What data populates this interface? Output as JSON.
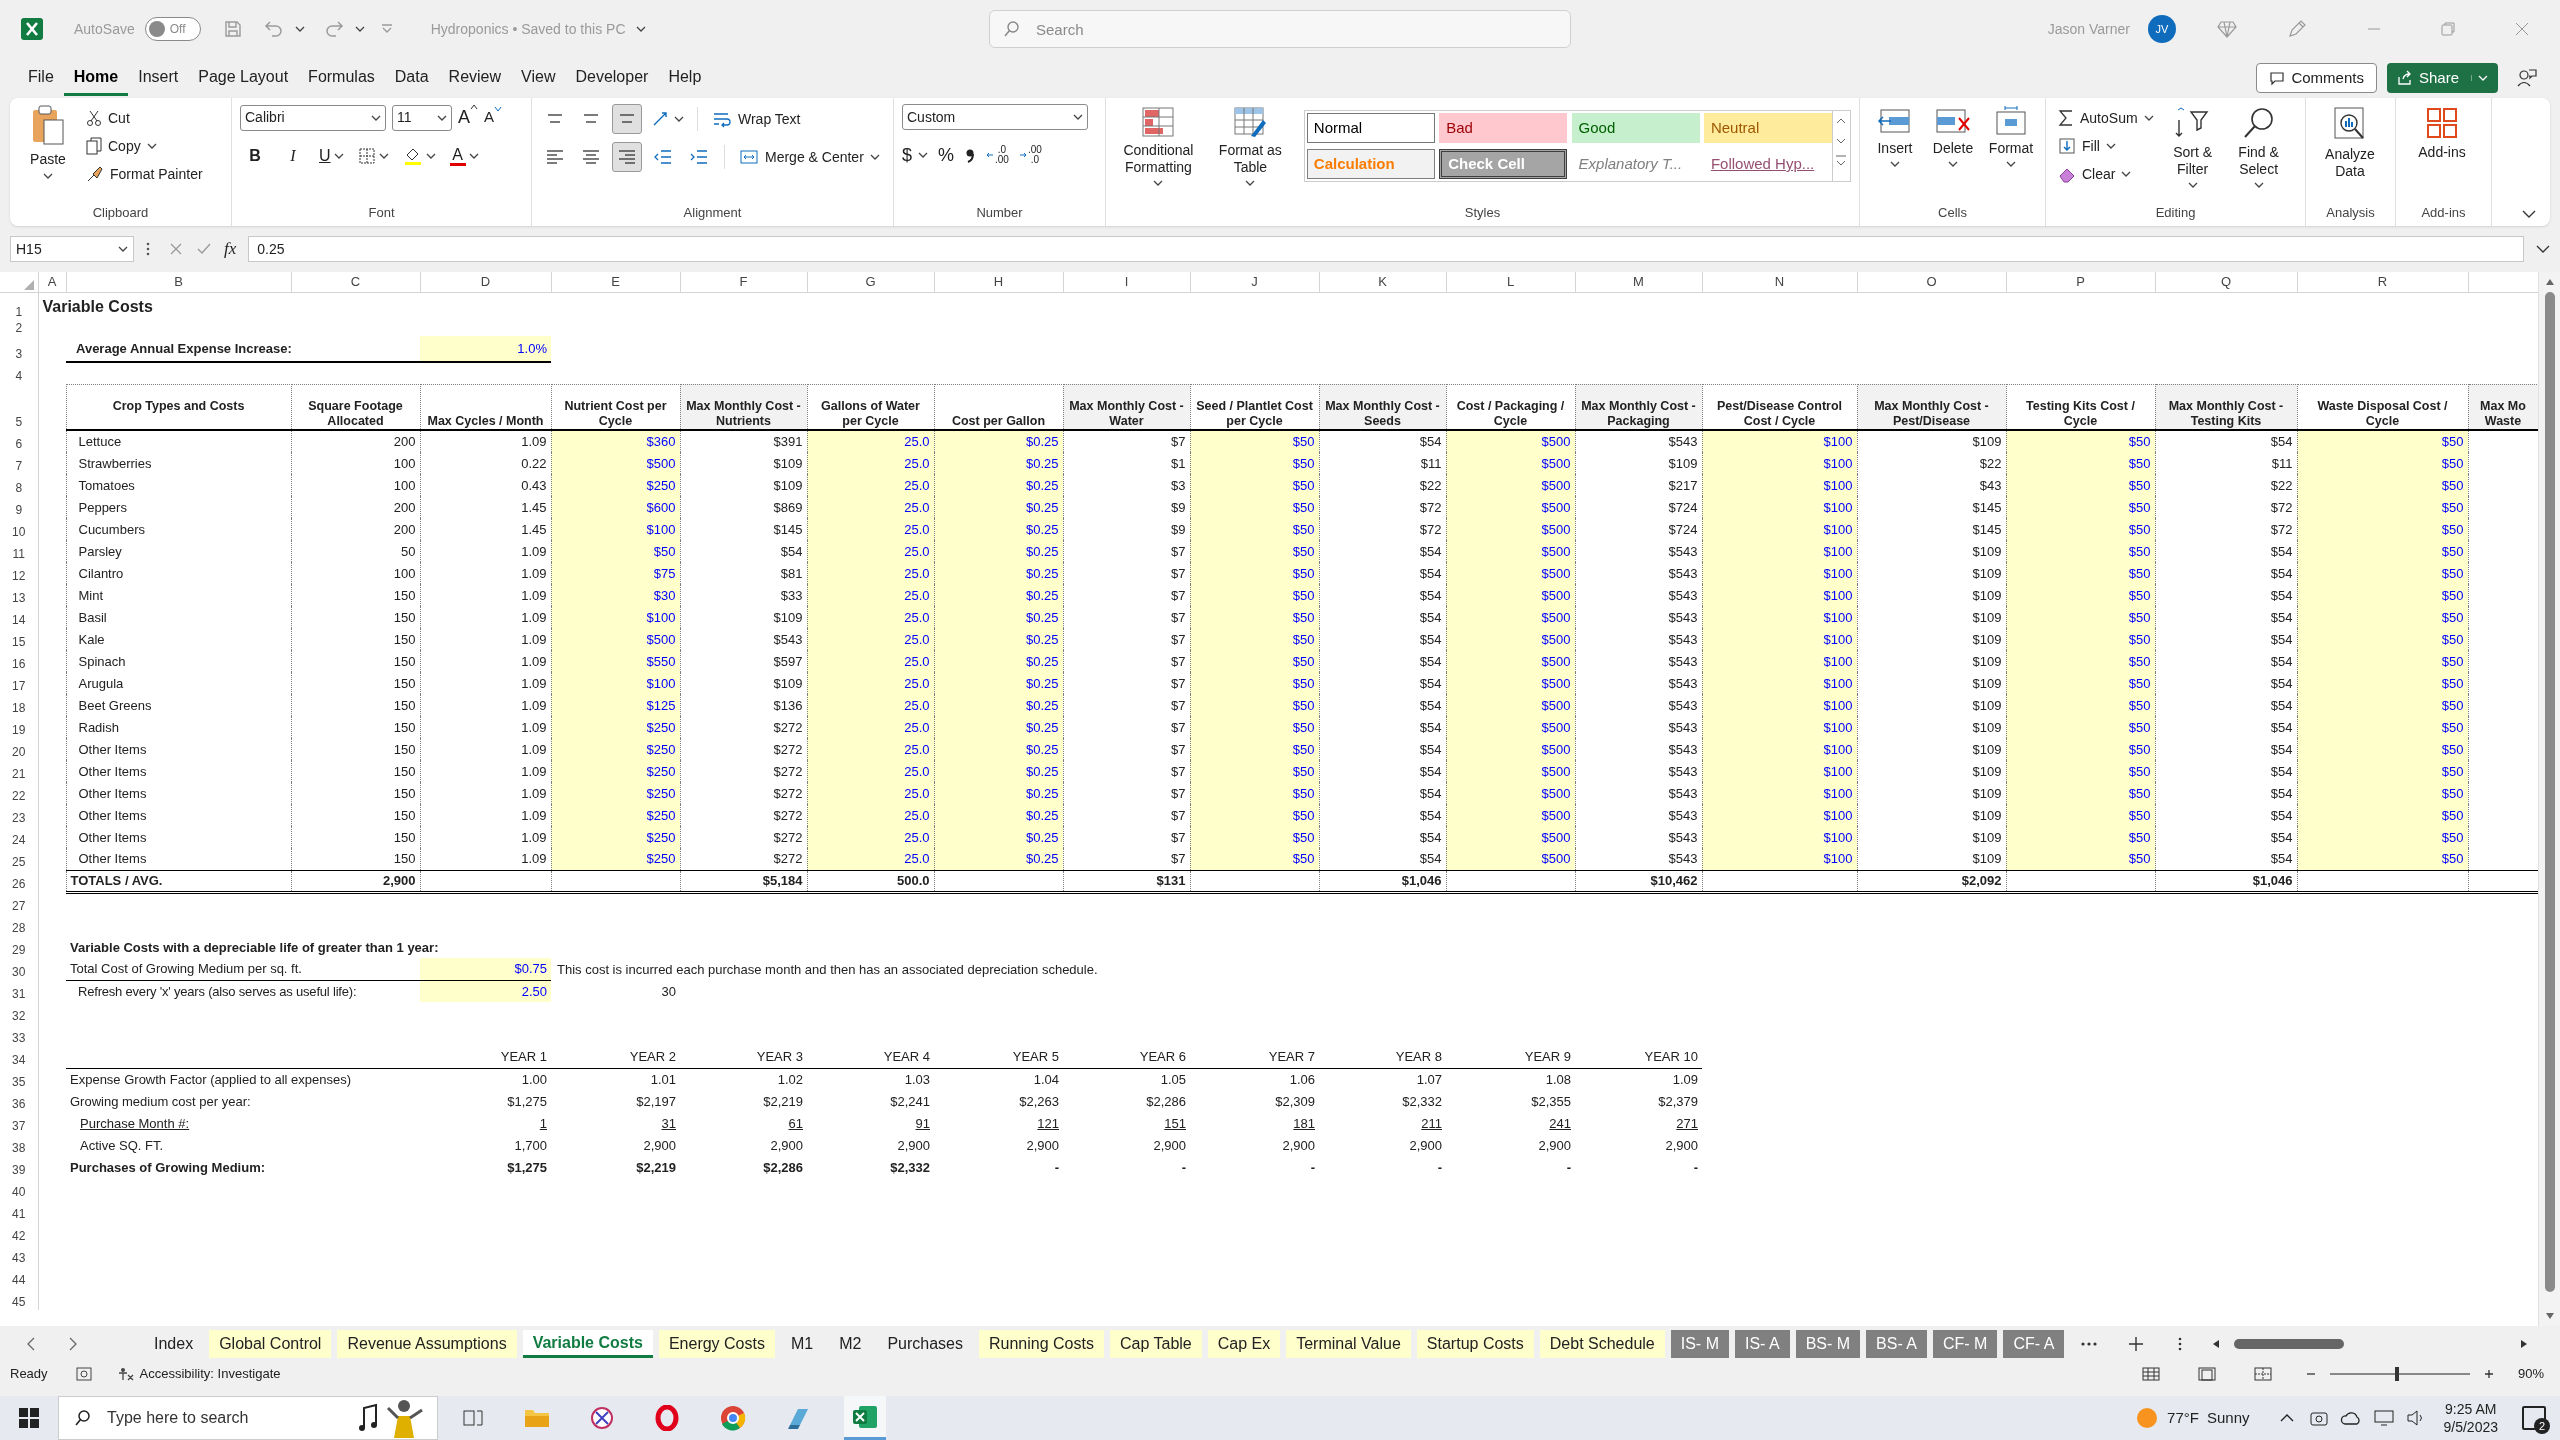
{
  "title_bar": {
    "autosave": {
      "label": "AutoSave",
      "state_text": "Off",
      "on": false
    },
    "document_title": "Hydroponics • Saved to this PC",
    "search_placeholder": "Search",
    "user_name": "Jason Varner",
    "user_initials": "JV"
  },
  "menu_tabs": [
    {
      "label": "File",
      "selected": false
    },
    {
      "label": "Home",
      "selected": true
    },
    {
      "label": "Insert",
      "selected": false
    },
    {
      "label": "Page Layout",
      "selected": false
    },
    {
      "label": "Formulas",
      "selected": false
    },
    {
      "label": "Data",
      "selected": false
    },
    {
      "label": "Review",
      "selected": false
    },
    {
      "label": "View",
      "selected": false
    },
    {
      "label": "Developer",
      "selected": false
    },
    {
      "label": "Help",
      "selected": false
    }
  ],
  "comments_button": "Comments",
  "share_button": "Share",
  "ribbon": {
    "clipboard": {
      "paste": "Paste",
      "cut": "Cut",
      "copy": "Copy",
      "format_painter": "Format Painter",
      "label": "Clipboard"
    },
    "font": {
      "font_name": "Calibri",
      "font_size": "11",
      "grow": "A",
      "shrink": "A",
      "bold": "B",
      "italic": "I",
      "underline": "U",
      "font_color": "A",
      "label": "Font"
    },
    "alignment": {
      "wrap_text": "Wrap Text",
      "merge_center": "Merge & Center",
      "label": "Alignment"
    },
    "number": {
      "format": "Custom",
      "currency": "$",
      "percent": "%",
      "decimal_increase": [
        ".0",
        ".00"
      ],
      "decimal_decrease": [
        ".00",
        ".0"
      ],
      "label": "Number"
    },
    "styles": {
      "conditional_formatting": "Conditional Formatting",
      "format_as_table": "Format as Table",
      "label": "Styles",
      "gallery": [
        {
          "label": "Normal",
          "kind": "normal"
        },
        {
          "label": "Bad",
          "kind": "bad"
        },
        {
          "label": "Good",
          "kind": "good"
        },
        {
          "label": "Neutral",
          "kind": "neutral"
        },
        {
          "label": "Calculation",
          "kind": "calculation"
        },
        {
          "label": "Check Cell",
          "kind": "check"
        },
        {
          "label": "Explanatory T...",
          "kind": "explanatory"
        },
        {
          "label": "Followed Hyp...",
          "kind": "followed"
        }
      ]
    },
    "cells": {
      "buttons": [
        "Insert",
        "Delete",
        "Format"
      ],
      "label": "Cells"
    },
    "editing": {
      "autosum": "AutoSum",
      "fill": "Fill",
      "clear": "Clear",
      "sort_filter": "Sort & Filter",
      "find_select": "Find & Select",
      "label": "Editing"
    },
    "analysis": {
      "analyze_data": "Analyze Data",
      "label": "Analysis"
    },
    "addins": {
      "addins": "Add-ins",
      "label": "Add-ins"
    }
  },
  "formula_bar": {
    "name_box": "H15",
    "fx": "fx",
    "value": "0.25"
  },
  "sheet": {
    "column_headers": [
      "A",
      "B",
      "C",
      "D",
      "E",
      "F",
      "G",
      "H",
      "I",
      "J",
      "K",
      "L",
      "M",
      "N",
      "O",
      "P",
      "Q",
      "R"
    ],
    "row_numbers": [
      "1",
      "2",
      "3",
      "4",
      "5",
      "6",
      "7",
      "8",
      "9",
      "10",
      "11",
      "12",
      "13",
      "14",
      "15",
      "16",
      "17",
      "18",
      "19",
      "20",
      "21",
      "22",
      "23",
      "24",
      "25",
      "26",
      "27",
      "28",
      "29",
      "30",
      "31",
      "32",
      "33",
      "34",
      "35",
      "36",
      "37",
      "38",
      "39",
      "40",
      "41",
      "42",
      "43",
      "44",
      "45"
    ],
    "title": "Variable Costs",
    "expense_increase": {
      "label": "Average Annual Expense Increase:",
      "value": "1.0%"
    },
    "crop_table": {
      "columns": [
        {
          "label": "Crop Types and Costs",
          "kind": "label"
        },
        {
          "label": "Square Footage Allocated",
          "kind": "plain"
        },
        {
          "label": "Max Cycles / Month",
          "kind": "plain"
        },
        {
          "label": "Nutrient Cost per Cycle",
          "kind": "input"
        },
        {
          "label": "Max Monthly Cost - Nutrients",
          "kind": "calc"
        },
        {
          "label": "Gallons of Water per Cycle",
          "kind": "input"
        },
        {
          "label": "Cost per Gallon",
          "kind": "input"
        },
        {
          "label": "Max Monthly Cost - Water",
          "kind": "calc"
        },
        {
          "label": "Seed / Plantlet Cost per Cycle",
          "kind": "input"
        },
        {
          "label": "Max Monthly Cost - Seeds",
          "kind": "calc"
        },
        {
          "label": "Cost / Packaging / Cycle",
          "kind": "input"
        },
        {
          "label": "Max Monthly Cost - Packaging",
          "kind": "calc"
        },
        {
          "label": "Pest/Disease Control Cost / Cycle",
          "kind": "input"
        },
        {
          "label": "Max Monthly Cost - Pest/Disease",
          "kind": "calc"
        },
        {
          "label": "Testing Kits Cost / Cycle",
          "kind": "input"
        },
        {
          "label": "Max Monthly Cost - Testing Kits",
          "kind": "calc"
        },
        {
          "label": "Waste Disposal Cost / Cycle",
          "kind": "input"
        },
        {
          "label": "Max Mo Waste",
          "kind": "calc"
        }
      ],
      "rows": [
        [
          "Lettuce",
          "200",
          "1.09",
          "$360",
          "$391",
          "25.0",
          "$0.25",
          "$7",
          "$50",
          "$54",
          "$500",
          "$543",
          "$100",
          "$109",
          "$50",
          "$54",
          "$50"
        ],
        [
          "Strawberries",
          "100",
          "0.22",
          "$500",
          "$109",
          "25.0",
          "$0.25",
          "$1",
          "$50",
          "$11",
          "$500",
          "$109",
          "$100",
          "$22",
          "$50",
          "$11",
          "$50"
        ],
        [
          "Tomatoes",
          "100",
          "0.43",
          "$250",
          "$109",
          "25.0",
          "$0.25",
          "$3",
          "$50",
          "$22",
          "$500",
          "$217",
          "$100",
          "$43",
          "$50",
          "$22",
          "$50"
        ],
        [
          "Peppers",
          "200",
          "1.45",
          "$600",
          "$869",
          "25.0",
          "$0.25",
          "$9",
          "$50",
          "$72",
          "$500",
          "$724",
          "$100",
          "$145",
          "$50",
          "$72",
          "$50"
        ],
        [
          "Cucumbers",
          "200",
          "1.45",
          "$100",
          "$145",
          "25.0",
          "$0.25",
          "$9",
          "$50",
          "$72",
          "$500",
          "$724",
          "$100",
          "$145",
          "$50",
          "$72",
          "$50"
        ],
        [
          "Parsley",
          "50",
          "1.09",
          "$50",
          "$54",
          "25.0",
          "$0.25",
          "$7",
          "$50",
          "$54",
          "$500",
          "$543",
          "$100",
          "$109",
          "$50",
          "$54",
          "$50"
        ],
        [
          "Cilantro",
          "100",
          "1.09",
          "$75",
          "$81",
          "25.0",
          "$0.25",
          "$7",
          "$50",
          "$54",
          "$500",
          "$543",
          "$100",
          "$109",
          "$50",
          "$54",
          "$50"
        ],
        [
          "Mint",
          "150",
          "1.09",
          "$30",
          "$33",
          "25.0",
          "$0.25",
          "$7",
          "$50",
          "$54",
          "$500",
          "$543",
          "$100",
          "$109",
          "$50",
          "$54",
          "$50"
        ],
        [
          "Basil",
          "150",
          "1.09",
          "$100",
          "$109",
          "25.0",
          "$0.25",
          "$7",
          "$50",
          "$54",
          "$500",
          "$543",
          "$100",
          "$109",
          "$50",
          "$54",
          "$50"
        ],
        [
          "Kale",
          "150",
          "1.09",
          "$500",
          "$543",
          "25.0",
          "$0.25",
          "$7",
          "$50",
          "$54",
          "$500",
          "$543",
          "$100",
          "$109",
          "$50",
          "$54",
          "$50"
        ],
        [
          "Spinach",
          "150",
          "1.09",
          "$550",
          "$597",
          "25.0",
          "$0.25",
          "$7",
          "$50",
          "$54",
          "$500",
          "$543",
          "$100",
          "$109",
          "$50",
          "$54",
          "$50"
        ],
        [
          "Arugula",
          "150",
          "1.09",
          "$100",
          "$109",
          "25.0",
          "$0.25",
          "$7",
          "$50",
          "$54",
          "$500",
          "$543",
          "$100",
          "$109",
          "$50",
          "$54",
          "$50"
        ],
        [
          "Beet Greens",
          "150",
          "1.09",
          "$125",
          "$136",
          "25.0",
          "$0.25",
          "$7",
          "$50",
          "$54",
          "$500",
          "$543",
          "$100",
          "$109",
          "$50",
          "$54",
          "$50"
        ],
        [
          "Radish",
          "150",
          "1.09",
          "$250",
          "$272",
          "25.0",
          "$0.25",
          "$7",
          "$50",
          "$54",
          "$500",
          "$543",
          "$100",
          "$109",
          "$50",
          "$54",
          "$50"
        ],
        [
          "Other Items",
          "150",
          "1.09",
          "$250",
          "$272",
          "25.0",
          "$0.25",
          "$7",
          "$50",
          "$54",
          "$500",
          "$543",
          "$100",
          "$109",
          "$50",
          "$54",
          "$50"
        ],
        [
          "Other Items",
          "150",
          "1.09",
          "$250",
          "$272",
          "25.0",
          "$0.25",
          "$7",
          "$50",
          "$54",
          "$500",
          "$543",
          "$100",
          "$109",
          "$50",
          "$54",
          "$50"
        ],
        [
          "Other Items",
          "150",
          "1.09",
          "$250",
          "$272",
          "25.0",
          "$0.25",
          "$7",
          "$50",
          "$54",
          "$500",
          "$543",
          "$100",
          "$109",
          "$50",
          "$54",
          "$50"
        ],
        [
          "Other Items",
          "150",
          "1.09",
          "$250",
          "$272",
          "25.0",
          "$0.25",
          "$7",
          "$50",
          "$54",
          "$500",
          "$543",
          "$100",
          "$109",
          "$50",
          "$54",
          "$50"
        ],
        [
          "Other Items",
          "150",
          "1.09",
          "$250",
          "$272",
          "25.0",
          "$0.25",
          "$7",
          "$50",
          "$54",
          "$500",
          "$543",
          "$100",
          "$109",
          "$50",
          "$54",
          "$50"
        ],
        [
          "Other Items",
          "150",
          "1.09",
          "$250",
          "$272",
          "25.0",
          "$0.25",
          "$7",
          "$50",
          "$54",
          "$500",
          "$543",
          "$100",
          "$109",
          "$50",
          "$54",
          "$50"
        ]
      ],
      "totals": {
        "label": "TOTALS / AVG.",
        "square_footage": "2,900",
        "nutrients": "$5,184",
        "water_gallons": "500.0",
        "water": "$131",
        "seeds": "$1,046",
        "packaging": "$10,462",
        "pest_disease": "$2,092",
        "testing_kits": "$1,046"
      }
    },
    "depreciable": {
      "heading": "Variable Costs with a depreciable life of greater than 1 year:",
      "medium_label": "Total Cost of Growing Medium per sq. ft.",
      "medium_value": "$0.75",
      "note": "This cost is incurred each purchase month and then has an associated depreciation schedule.",
      "refresh_label": "Refresh every 'x' years (also serves as useful life):",
      "refresh_value": "2.50",
      "refresh_months": "30"
    },
    "schedule": {
      "years": [
        "YEAR 1",
        "YEAR 2",
        "YEAR 3",
        "YEAR 4",
        "YEAR 5",
        "YEAR 6",
        "YEAR 7",
        "YEAR 8",
        "YEAR 9",
        "YEAR 10"
      ],
      "rows": [
        {
          "label": "Expense Growth Factor (applied to all expenses)",
          "kind": "plain",
          "values": [
            "1.00",
            "1.01",
            "1.02",
            "1.03",
            "1.04",
            "1.05",
            "1.06",
            "1.07",
            "1.08",
            "1.09"
          ]
        },
        {
          "label": "Growing medium cost per year:",
          "kind": "plain",
          "values": [
            "$1,275",
            "$2,197",
            "$2,219",
            "$2,241",
            "$2,263",
            "$2,286",
            "$2,309",
            "$2,332",
            "$2,355",
            "$2,379"
          ]
        },
        {
          "label": "Purchase Month #:",
          "kind": "link",
          "values": [
            "1",
            "31",
            "61",
            "91",
            "121",
            "151",
            "181",
            "211",
            "241",
            "271"
          ]
        },
        {
          "label": "Active SQ. FT.",
          "kind": "indented",
          "values": [
            "1,700",
            "2,900",
            "2,900",
            "2,900",
            "2,900",
            "2,900",
            "2,900",
            "2,900",
            "2,900",
            "2,900"
          ]
        },
        {
          "label": "Purchases of Growing Medium:",
          "kind": "total",
          "values": [
            "$1,275",
            "$2,219",
            "$2,286",
            "$2,332",
            "-",
            "-",
            "-",
            "-",
            "-",
            "-"
          ]
        }
      ]
    }
  },
  "sheet_tabs": [
    {
      "label": "Index",
      "selected": false,
      "color": "#f0f0f0"
    },
    {
      "label": "Global Control",
      "selected": false,
      "color": "#ffffcc"
    },
    {
      "label": "Revenue Assumptions",
      "selected": false,
      "color": "#ffffcc"
    },
    {
      "label": "Variable Costs",
      "selected": true,
      "color": "#ffffff"
    },
    {
      "label": "Energy Costs",
      "selected": false,
      "color": "#ffffcc"
    },
    {
      "label": "M1",
      "selected": false,
      "color": "#f0f0f0"
    },
    {
      "label": "M2",
      "selected": false,
      "color": "#f0f0f0"
    },
    {
      "label": "Purchases",
      "selected": false,
      "color": "#f0f0f0"
    },
    {
      "label": "Running Costs",
      "selected": false,
      "color": "#ffffcc"
    },
    {
      "label": "Cap Table",
      "selected": false,
      "color": "#ffffcc"
    },
    {
      "label": "Cap Ex",
      "selected": false,
      "color": "#ffffcc"
    },
    {
      "label": "Terminal Value",
      "selected": false,
      "color": "#ffffcc"
    },
    {
      "label": "Startup Costs",
      "selected": false,
      "color": "#ffffcc"
    },
    {
      "label": "Debt Schedule",
      "selected": false,
      "color": "#ffffcc"
    },
    {
      "label": "IS- M",
      "selected": false,
      "color": "#808080"
    },
    {
      "label": "IS- A",
      "selected": false,
      "color": "#808080"
    },
    {
      "label": "BS- M",
      "selected": false,
      "color": "#808080"
    },
    {
      "label": "BS- A",
      "selected": false,
      "color": "#808080"
    },
    {
      "label": "CF- M",
      "selected": false,
      "color": "#808080"
    },
    {
      "label": "CF- A",
      "selected": false,
      "color": "#808080"
    }
  ],
  "status_bar": {
    "ready": "Ready",
    "accessibility": "Accessibility: Investigate",
    "zoom": "90%",
    "zoom_slider": {
      "level": 0.48
    }
  },
  "taskbar": {
    "search_placeholder": "Type here to search",
    "temperature": "77°F",
    "condition": "Sunny",
    "time": "9:25 AM",
    "date": "9/5/2023",
    "notifications": "2"
  }
}
